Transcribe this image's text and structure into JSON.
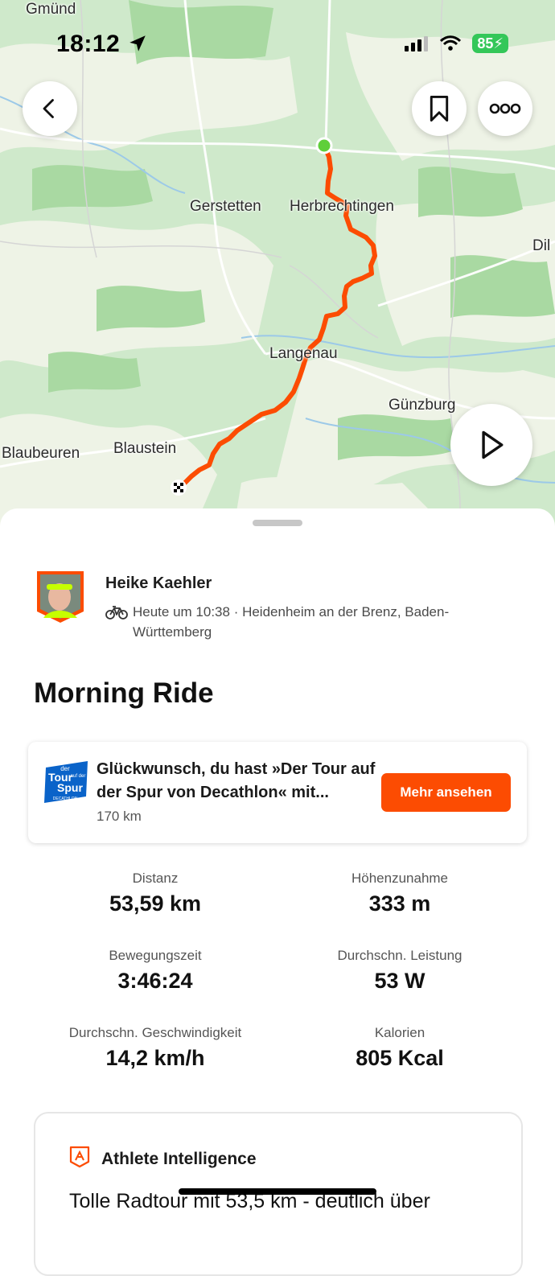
{
  "status_bar": {
    "time": "18:12",
    "battery": "85"
  },
  "map": {
    "labels": {
      "gmuend": "Gmünd",
      "gerstetten": "Gerstetten",
      "herbrechtingen": "Herbrechtingen",
      "dil": "Dil",
      "langenau": "Langenau",
      "guenzburg": "Günzburg",
      "blaubeuren": "Blaubeuren",
      "blaustein": "Blaustein"
    },
    "route_color": "#fc4c02",
    "start_color": "#5fcf3a"
  },
  "activity": {
    "athlete_name": "Heike Kaehler",
    "meta": "Heute um 10:38 · Heidenheim an der Brenz, Baden-Württemberg",
    "title": "Morning Ride"
  },
  "challenge": {
    "title": "Glückwunsch, du hast »Der Tour auf der Spur von Decathlon« mit...",
    "subtitle": "170 km",
    "button": "Mehr ansehen",
    "badge_text": [
      "der",
      "Tour",
      "auf der",
      "Spur",
      "DECATHLON"
    ]
  },
  "stats": [
    {
      "label": "Distanz",
      "value": "53,59 km"
    },
    {
      "label": "Höhenzunahme",
      "value": "333 m"
    },
    {
      "label": "Bewegungszeit",
      "value": "3:46:24"
    },
    {
      "label": "Durchschn. Leistung",
      "value": "53 W"
    },
    {
      "label": "Durchschn. Geschwindigkeit",
      "value": "14,2 km/h"
    },
    {
      "label": "Kalorien",
      "value": "805 Kcal"
    }
  ],
  "athlete_intelligence": {
    "title": "Athlete Intelligence",
    "text": "Tolle Radtour mit 53,5 km - deutlich über"
  },
  "colors": {
    "accent": "#fc4c02"
  }
}
